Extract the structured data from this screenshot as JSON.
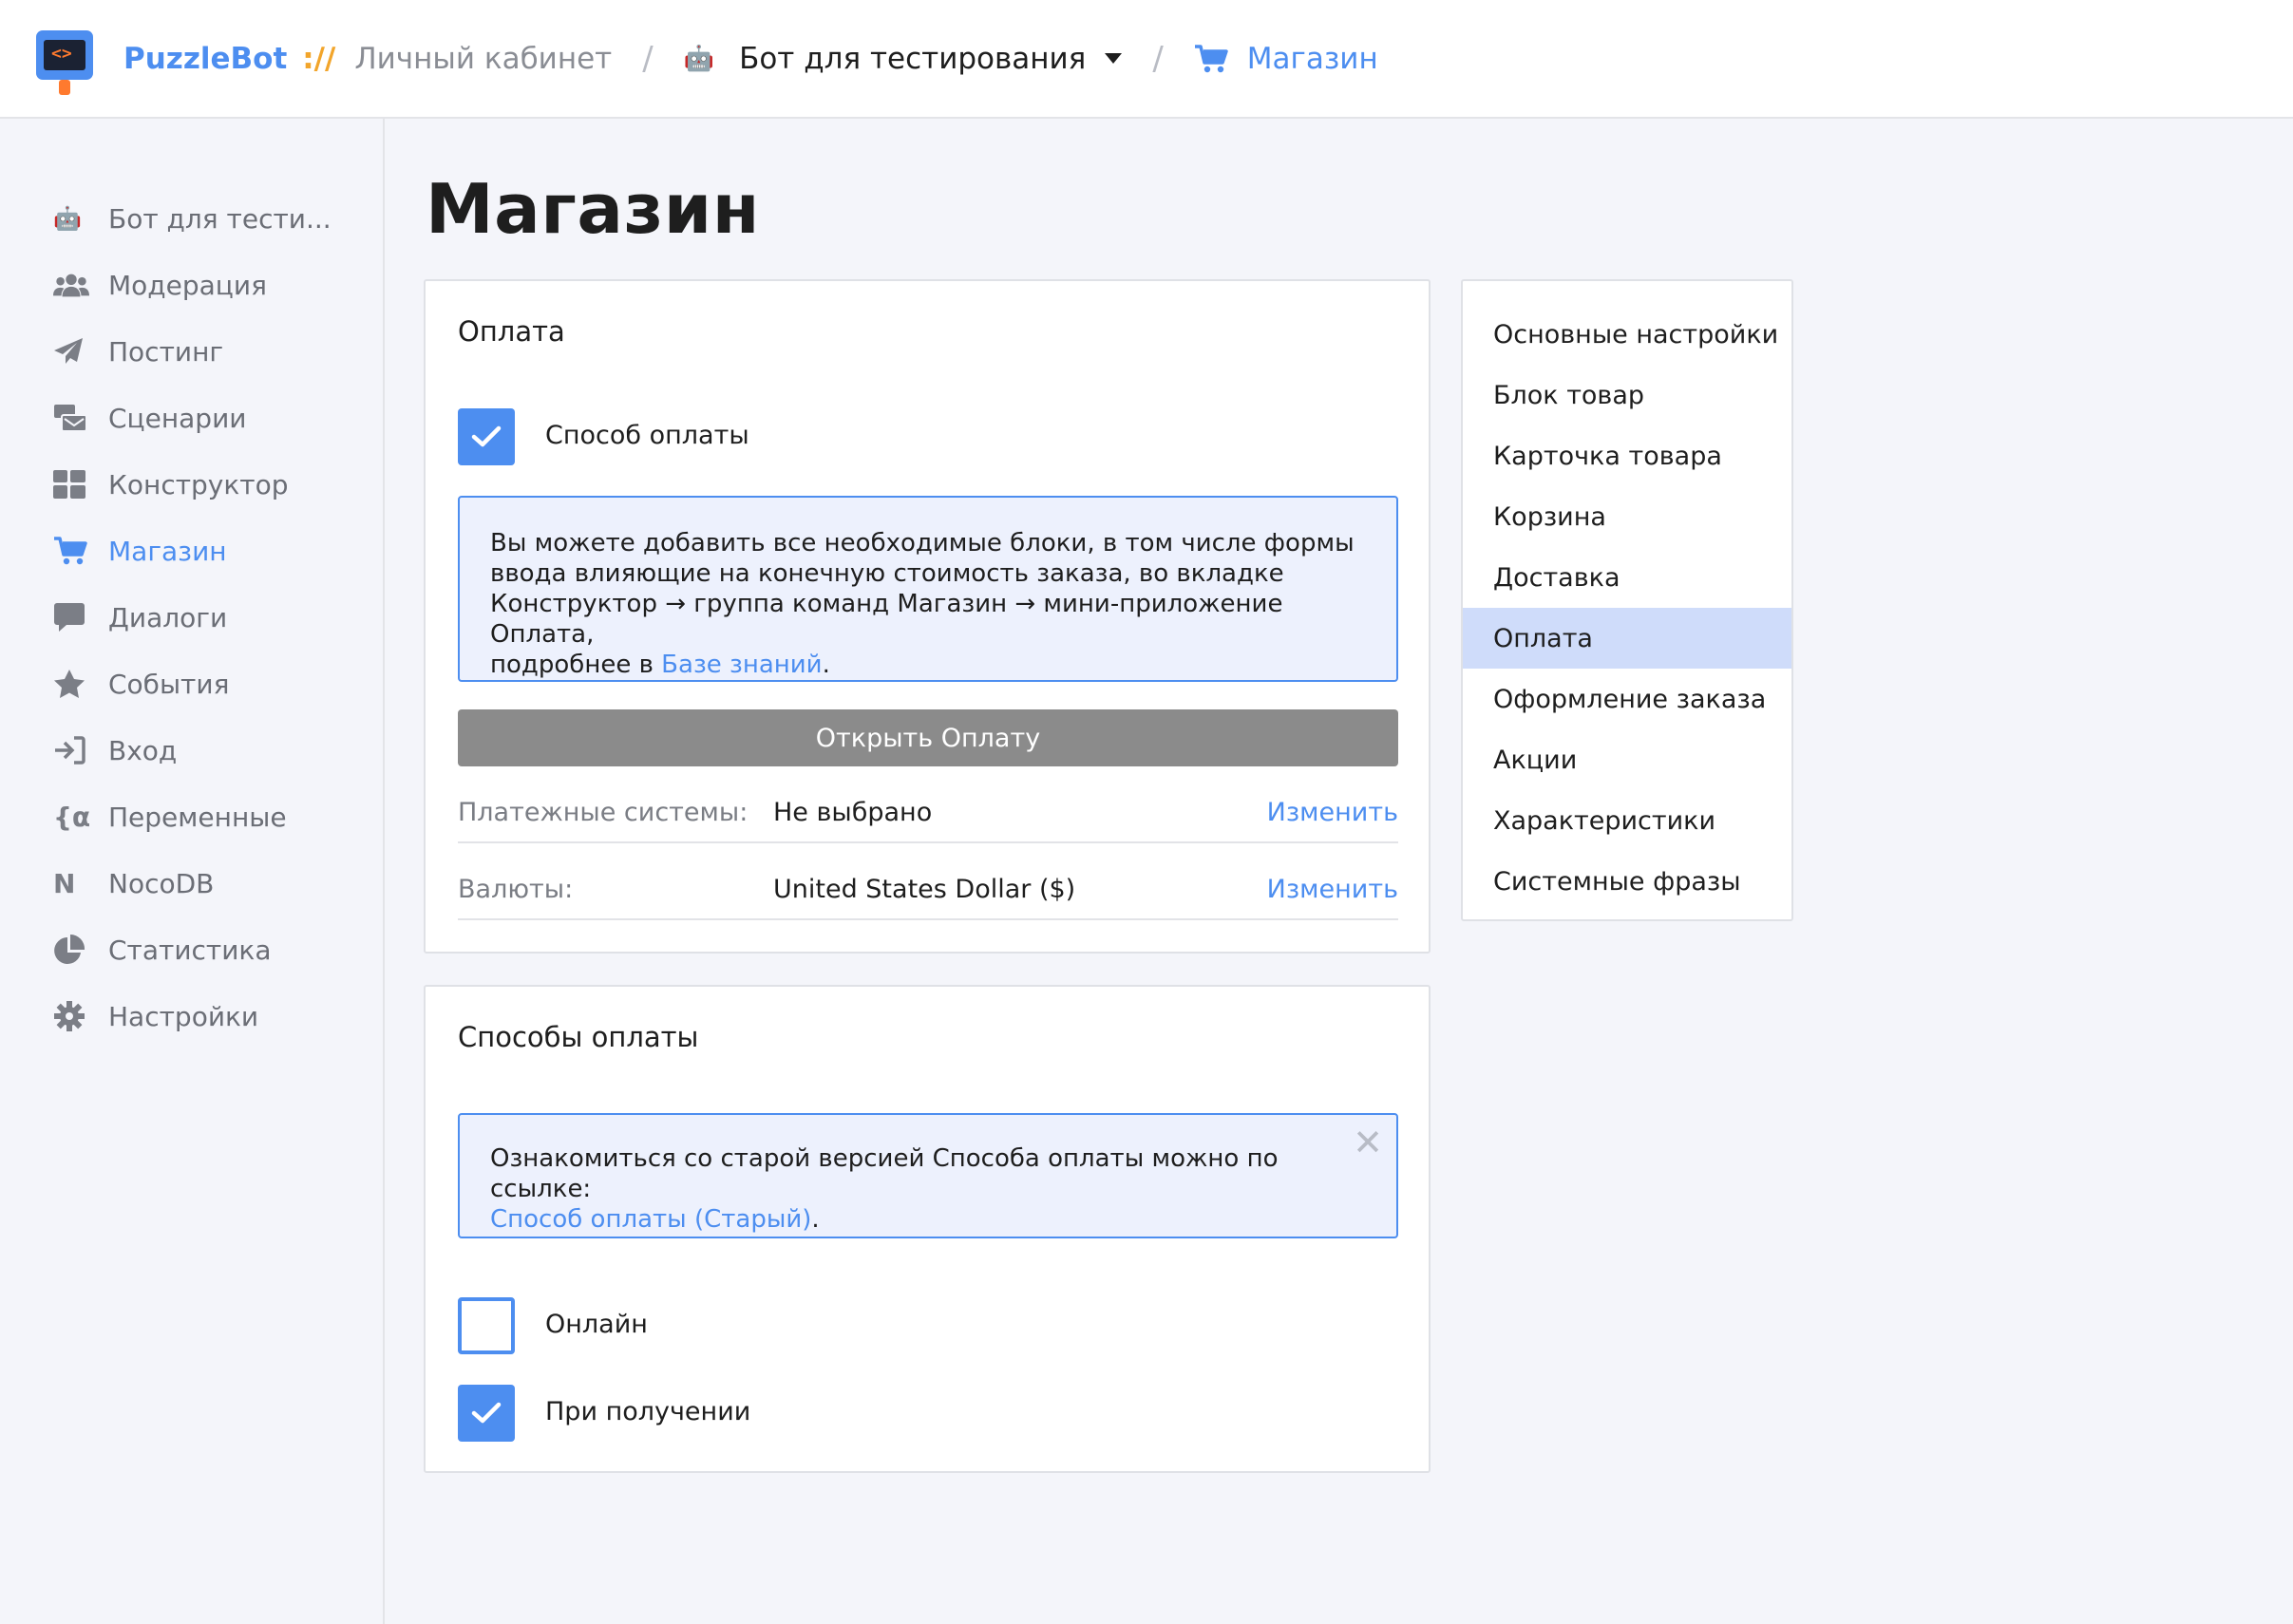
{
  "header": {
    "brand": "PuzzleBot",
    "brand_sep": "://",
    "cabinet": "Личный кабинет",
    "separator": "/",
    "bot_name": "Бот для тестирования",
    "current": "Магазин",
    "bot_emoji": "🤖"
  },
  "sidebar": {
    "items": [
      {
        "label": "Бот для тести...",
        "icon": "robot-icon"
      },
      {
        "label": "Модерация",
        "icon": "users-icon"
      },
      {
        "label": "Постинг",
        "icon": "paper-plane-icon"
      },
      {
        "label": "Сценарии",
        "icon": "mail-bulk-icon"
      },
      {
        "label": "Конструктор",
        "icon": "grid-icon"
      },
      {
        "label": "Магазин",
        "icon": "cart-icon",
        "active": true
      },
      {
        "label": "Диалоги",
        "icon": "comment-icon"
      },
      {
        "label": "События",
        "icon": "star-icon"
      },
      {
        "label": "Вход",
        "icon": "sign-in-icon"
      },
      {
        "label": "Переменные",
        "icon": "variable-icon"
      },
      {
        "label": "NocoDB",
        "icon": "nocodb-icon"
      },
      {
        "label": "Статистика",
        "icon": "pie-chart-icon"
      },
      {
        "label": "Настройки",
        "icon": "gear-icon"
      }
    ]
  },
  "main": {
    "title": "Магазин",
    "payment": {
      "title": "Оплата",
      "method_checkbox_label": "Способ оплаты",
      "method_checked": true,
      "info_line1": "Вы можете добавить все необходимые блоки, в том числе формы",
      "info_line2": "ввода влияющие на конечную стоимость заказа, во вкладке",
      "info_line3": "Конструктор → группа команд Магазин → мини-приложение Оплата,",
      "info_line4_prefix": "подробнее в ",
      "info_link": "Базе знаний",
      "info_line4_suffix": ".",
      "open_button": "Открыть Оплату",
      "rows": [
        {
          "label": "Платежные системы:",
          "value": "Не выбрано",
          "action": "Изменить"
        },
        {
          "label": "Валюты:",
          "value": "United States Dollar ($)",
          "action": "Изменить"
        }
      ]
    },
    "methods": {
      "title": "Способы оплаты",
      "notice_text": "Ознакомиться со старой версией Способа оплаты можно по ссылке:",
      "notice_link": "Способ оплаты (Старый)",
      "notice_suffix": ".",
      "close_symbol": "✕",
      "options": [
        {
          "label": "Онлайн",
          "checked": false
        },
        {
          "label": "При получении",
          "checked": true
        }
      ]
    }
  },
  "right_menu": {
    "items": [
      {
        "label": "Основные настройки"
      },
      {
        "label": "Блок товар"
      },
      {
        "label": "Карточка товара"
      },
      {
        "label": "Корзина"
      },
      {
        "label": "Доставка"
      },
      {
        "label": "Оплата",
        "active": true
      },
      {
        "label": "Оформление заказа"
      },
      {
        "label": "Акции"
      },
      {
        "label": "Характеристики"
      },
      {
        "label": "Системные фразы"
      }
    ]
  },
  "colors": {
    "accent": "#4d8ef0",
    "brand_separator": "#f2a52b",
    "background": "#f4f5fa",
    "active_menu": "#cfdcfa",
    "button_gray": "#8b8b8b",
    "info_bg": "#edf1fd"
  }
}
